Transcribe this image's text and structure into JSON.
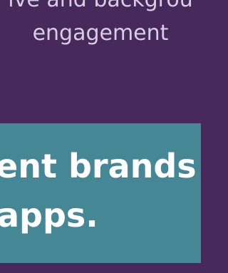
{
  "top": {
    "line1": "ive and backgrou",
    "line2": "engagement"
  },
  "band": {
    "line1": "ent brands",
    "line2": "apps."
  },
  "colors": {
    "background": "#472a5b",
    "band": "#458795",
    "top_text": "#d9cde6",
    "band_text": "#ffffff"
  }
}
